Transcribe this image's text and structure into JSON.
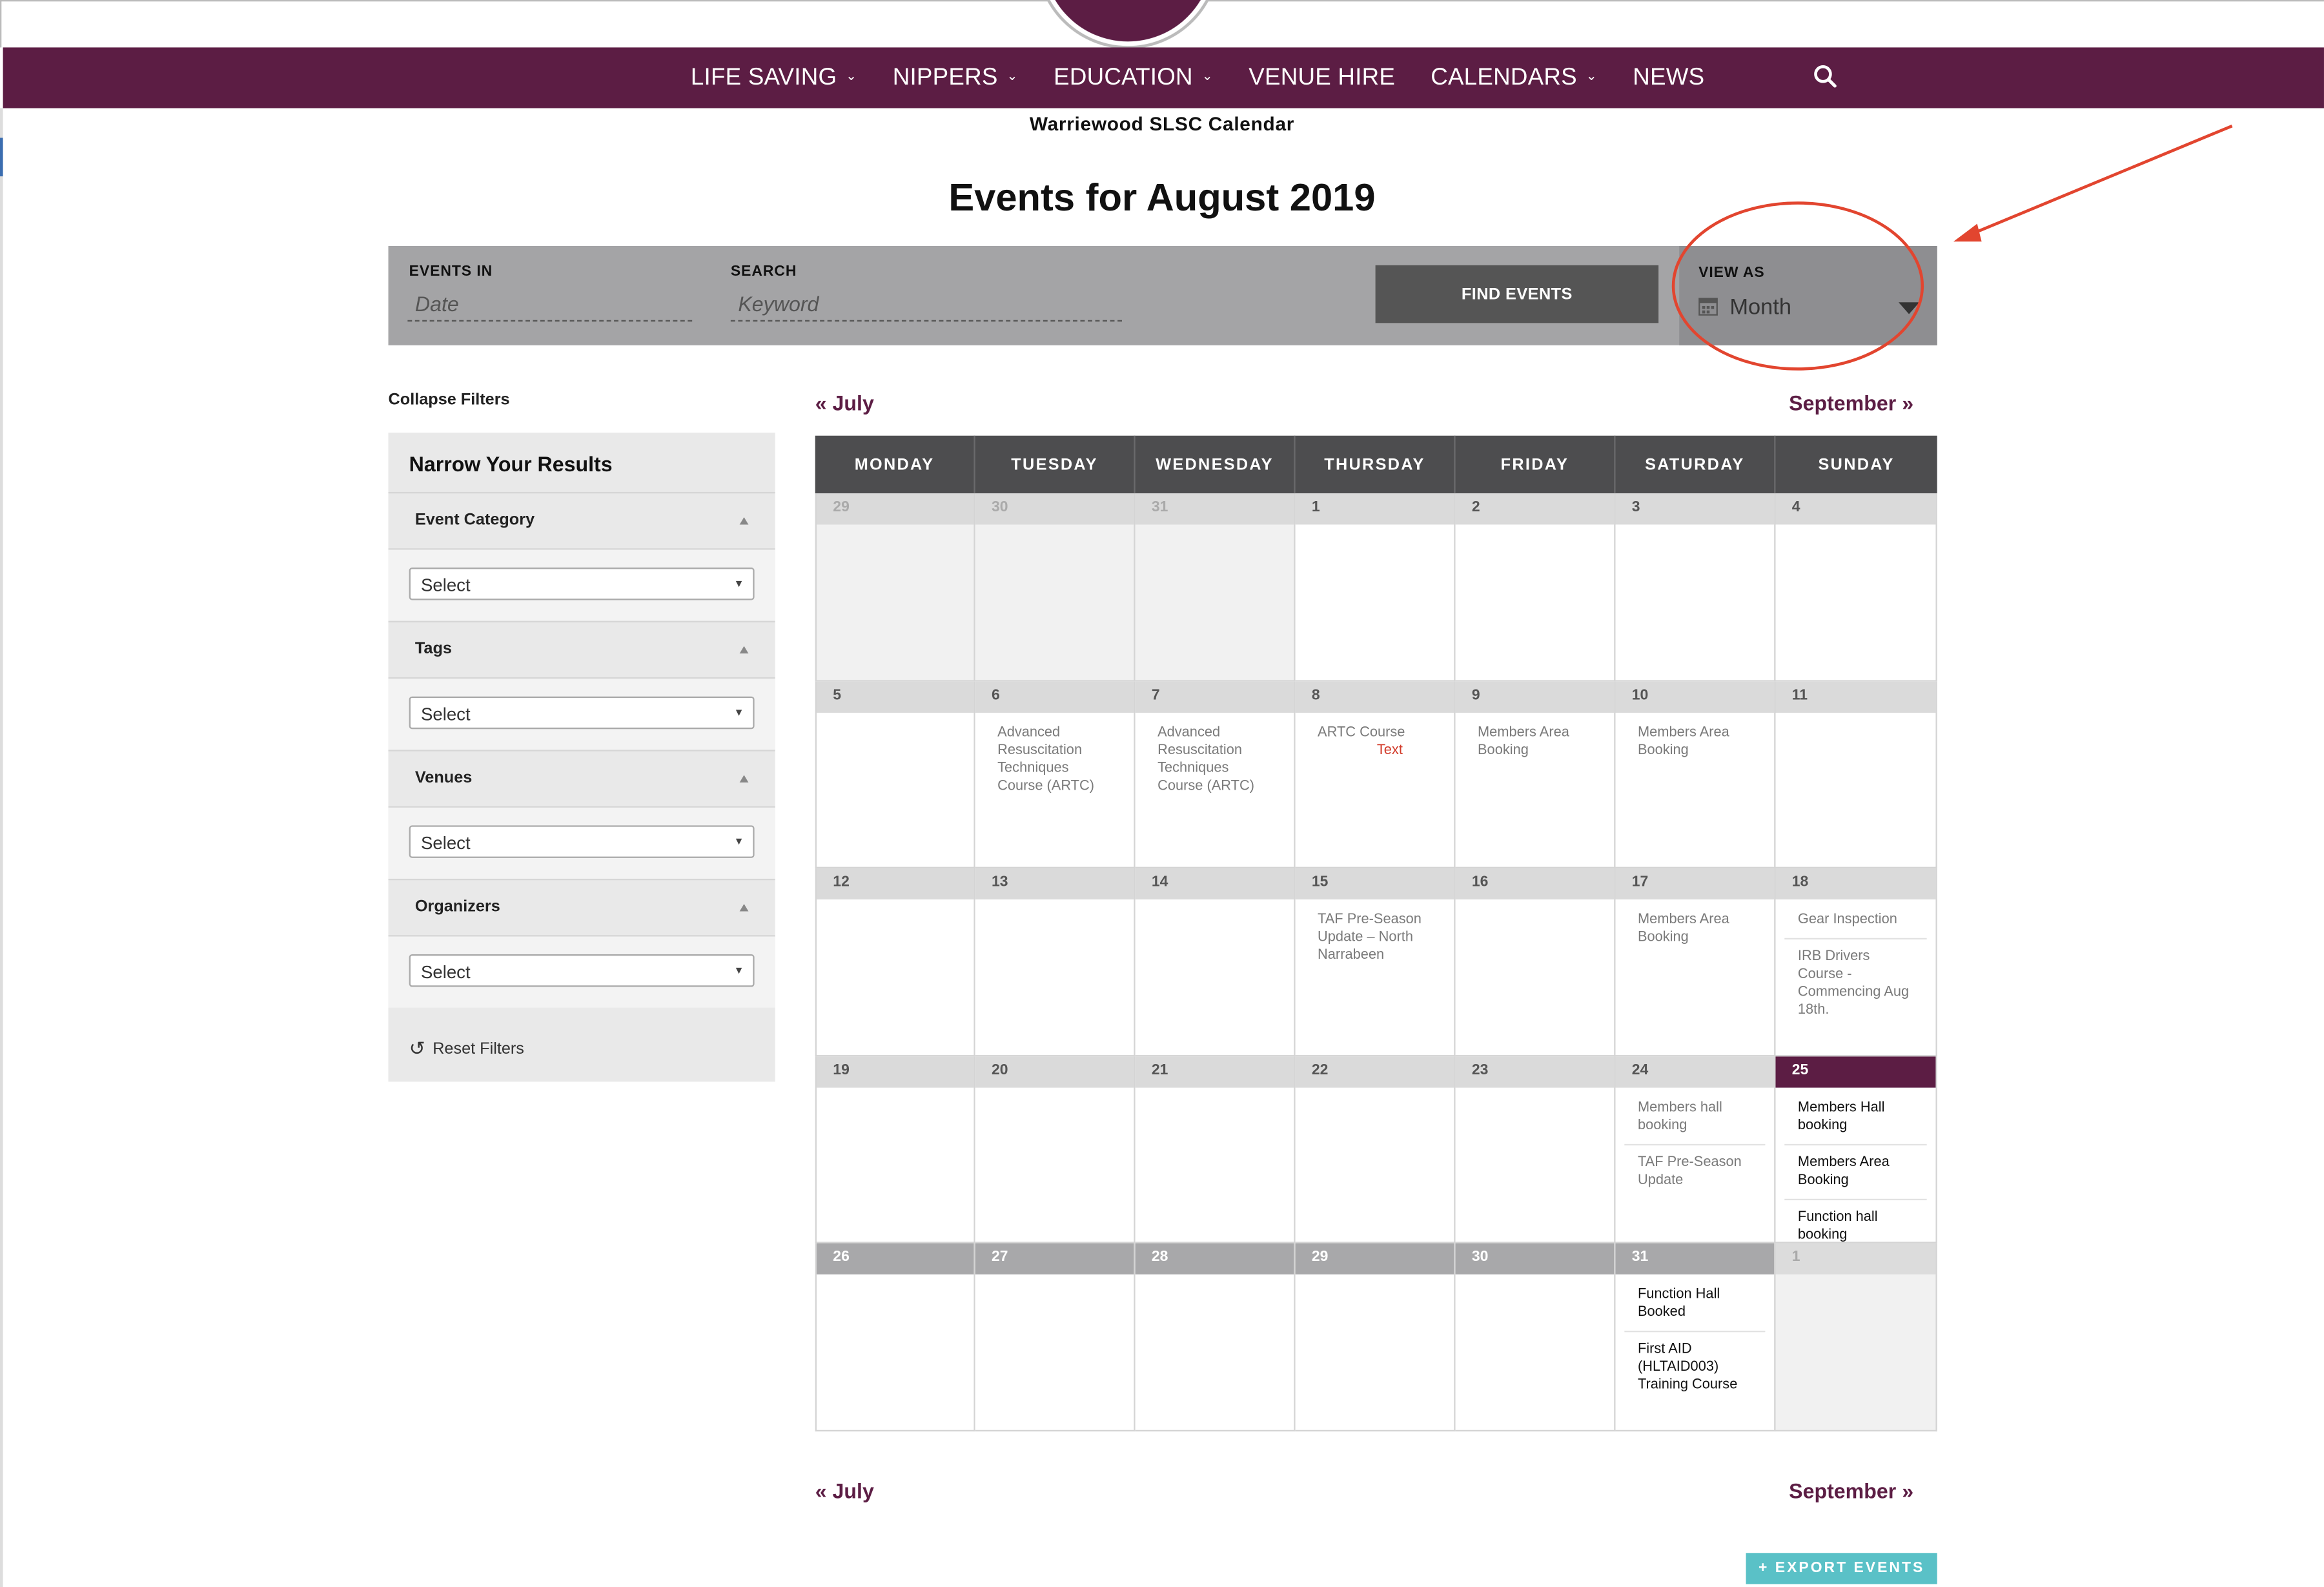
{
  "nav": {
    "items": [
      {
        "label": "LIFE SAVING",
        "has_dropdown": true
      },
      {
        "label": "NIPPERS",
        "has_dropdown": true
      },
      {
        "label": "EDUCATION",
        "has_dropdown": true
      },
      {
        "label": "VENUE HIRE",
        "has_dropdown": false
      },
      {
        "label": "CALENDARS",
        "has_dropdown": true
      },
      {
        "label": "NEWS",
        "has_dropdown": false
      }
    ],
    "chevron": "⌄",
    "search_icon": "search-icon"
  },
  "site_caption": "Warriewood SLSC Calendar",
  "page_title": "Events for August 2019",
  "filters": {
    "events_in_label": "EVENTS IN",
    "events_in_placeholder": "Date",
    "search_label": "SEARCH",
    "search_placeholder": "Keyword",
    "find_button": "FIND EVENTS",
    "view_as_label": "VIEW AS",
    "view_as_value": "Month"
  },
  "sidebar": {
    "collapse_link": "Collapse Filters",
    "title": "Narrow Your Results",
    "sections": [
      {
        "name": "Event Category",
        "select": "Select"
      },
      {
        "name": "Tags",
        "select": "Select"
      },
      {
        "name": "Venues",
        "select": "Select"
      },
      {
        "name": "Organizers",
        "select": "Select"
      }
    ],
    "reset": "Reset Filters"
  },
  "month_nav": {
    "prev": "« July",
    "next": "September »"
  },
  "calendar": {
    "weekdays": [
      "MONDAY",
      "TUESDAY",
      "WEDNESDAY",
      "THURSDAY",
      "FRIDAY",
      "SATURDAY",
      "SUNDAY"
    ],
    "weeks": [
      [
        {
          "num": "29",
          "other": true,
          "events": []
        },
        {
          "num": "30",
          "other": true,
          "events": []
        },
        {
          "num": "31",
          "other": true,
          "events": []
        },
        {
          "num": "1",
          "events": []
        },
        {
          "num": "2",
          "events": []
        },
        {
          "num": "3",
          "events": []
        },
        {
          "num": "4",
          "events": []
        }
      ],
      [
        {
          "num": "5",
          "events": []
        },
        {
          "num": "6",
          "events": [
            {
              "title": "Advanced Resuscitation Techniques Course (ARTC)"
            }
          ]
        },
        {
          "num": "7",
          "events": [
            {
              "title": "Advanced Resuscitation Techniques Course (ARTC)"
            }
          ]
        },
        {
          "num": "8",
          "events": [
            {
              "title": "ARTC Course",
              "note": "Text"
            }
          ]
        },
        {
          "num": "9",
          "events": [
            {
              "title": "Members Area Booking"
            }
          ]
        },
        {
          "num": "10",
          "events": [
            {
              "title": "Members Area Booking"
            }
          ]
        },
        {
          "num": "11",
          "events": []
        }
      ],
      [
        {
          "num": "12",
          "events": []
        },
        {
          "num": "13",
          "events": []
        },
        {
          "num": "14",
          "events": []
        },
        {
          "num": "15",
          "events": [
            {
              "title": "TAF Pre-Season Update – North Narrabeen"
            }
          ]
        },
        {
          "num": "16",
          "events": []
        },
        {
          "num": "17",
          "events": [
            {
              "title": "Members Area Booking"
            }
          ]
        },
        {
          "num": "18",
          "events": [
            {
              "title": "Gear Inspection"
            },
            {
              "title": "IRB Drivers Course - Commencing Aug 18th."
            }
          ]
        }
      ],
      [
        {
          "num": "19",
          "events": []
        },
        {
          "num": "20",
          "events": []
        },
        {
          "num": "21",
          "events": []
        },
        {
          "num": "22",
          "events": []
        },
        {
          "num": "23",
          "events": []
        },
        {
          "num": "24",
          "events": [
            {
              "title": "Members hall booking"
            },
            {
              "title": "TAF Pre-Season Update"
            }
          ]
        },
        {
          "num": "25",
          "today": true,
          "events": [
            {
              "title": "Members Hall booking",
              "dark": true
            },
            {
              "title": "Members Area Booking",
              "dark": true
            },
            {
              "title": "Function hall booking",
              "dark": true
            }
          ]
        }
      ],
      [
        {
          "num": "26",
          "events": []
        },
        {
          "num": "27",
          "events": []
        },
        {
          "num": "28",
          "events": []
        },
        {
          "num": "29",
          "events": []
        },
        {
          "num": "30",
          "events": []
        },
        {
          "num": "31",
          "events": [
            {
              "title": "Function Hall Booked",
              "dark": true
            },
            {
              "title": "First AID (HLTAID003) Training Course",
              "dark": true
            }
          ]
        },
        {
          "num": "1",
          "other": true,
          "events": []
        }
      ]
    ]
  },
  "export_button": "+ EXPORT EVENTS",
  "colors": {
    "brand": "#5c1d44",
    "filter_bar": "#a4a4a6",
    "annotation": "#e2452f",
    "export": "#5ac1c7"
  }
}
